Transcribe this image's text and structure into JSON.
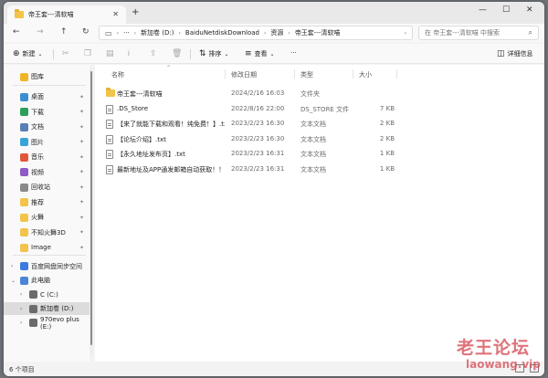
{
  "tab": {
    "title": "帝王套---清软喵",
    "icon": "folder-icon"
  },
  "window_controls": {
    "minimize": "—",
    "maximize": "☐",
    "close": "✕"
  },
  "nav": {
    "back": "←",
    "forward": "→",
    "up": "↑",
    "refresh": "↻",
    "more": "···"
  },
  "breadcrumb": [
    "新加卷 (D:)",
    "BaiduNetdiskDownload",
    "资源",
    "帝王套---清软喵"
  ],
  "search": {
    "placeholder": "在 帝王套---清软喵 中搜索"
  },
  "commands": {
    "new_label": "新建",
    "sort_label": "排序",
    "view_label": "查看",
    "more": "···",
    "details_label": "详细信息"
  },
  "columns": {
    "name": "名称",
    "modified": "修改日期",
    "type": "类型",
    "size": "大小"
  },
  "files": [
    {
      "name": "帝王套---清软喵",
      "modified": "2024/2/16 16:03",
      "type": "文件夹",
      "size": "",
      "icon": "folder-icon"
    },
    {
      "name": ".DS_Store",
      "modified": "2022/8/16 22:00",
      "type": "DS_STORE 文件",
      "size": "7 KB",
      "icon": "file-icon"
    },
    {
      "name": "【来了就能下载和观看！纯免费！】.txt",
      "modified": "2023/2/23 16:30",
      "type": "文本文档",
      "size": "2 KB",
      "icon": "file-icon"
    },
    {
      "name": "【论坛介绍】.txt",
      "modified": "2023/2/23 16:30",
      "type": "文本文档",
      "size": "2 KB",
      "icon": "file-icon"
    },
    {
      "name": "【永久地址发布页】.txt",
      "modified": "2023/2/23 16:31",
      "type": "文本文档",
      "size": "1 KB",
      "icon": "file-icon"
    },
    {
      "name": "最新地址及APP通发邮箱自动获取！！！...",
      "modified": "2023/2/23 16:31",
      "type": "文本文档",
      "size": "1 KB",
      "icon": "file-icon"
    }
  ],
  "sidebar": {
    "top_item": {
      "label": "图库",
      "color": "#f0b429"
    },
    "pinned": [
      {
        "label": "桌面",
        "color": "#3b8ed0"
      },
      {
        "label": "下载",
        "color": "#2e9e5b"
      },
      {
        "label": "文档",
        "color": "#5a7fb5"
      },
      {
        "label": "图片",
        "color": "#3aa3d6"
      },
      {
        "label": "音乐",
        "color": "#e0573a"
      },
      {
        "label": "视频",
        "color": "#8e5bc7"
      },
      {
        "label": "回收站",
        "color": "#8a8a8a"
      },
      {
        "label": "推荐",
        "color": "#f3c34a"
      },
      {
        "label": "火舞",
        "color": "#f3c34a"
      },
      {
        "label": "不知火舞3D",
        "color": "#f3c34a"
      },
      {
        "label": "Image",
        "color": "#f3c34a"
      }
    ],
    "tree": [
      {
        "label": "百度网盘同步空间",
        "color": "#3b7be0",
        "indent": 0,
        "expanded": false
      },
      {
        "label": "此电脑",
        "color": "#4a86d6",
        "indent": 0,
        "expanded": true
      },
      {
        "label": "C (C:)",
        "color": "#6b6b6b",
        "indent": 1,
        "expanded": false
      },
      {
        "label": "新加卷 (D:)",
        "color": "#6b6b6b",
        "indent": 1,
        "expanded": false,
        "selected": true
      },
      {
        "label": "970evo plus (E:)",
        "color": "#6b6b6b",
        "indent": 1,
        "expanded": false
      }
    ]
  },
  "status": {
    "item_count": "6 个项目"
  },
  "watermark": {
    "main": "老王论坛",
    "sub": "laowang.vip"
  },
  "colors": {
    "accent": "#0067c0",
    "folder": "#f3c34a",
    "selection": "#dcdcdc"
  }
}
